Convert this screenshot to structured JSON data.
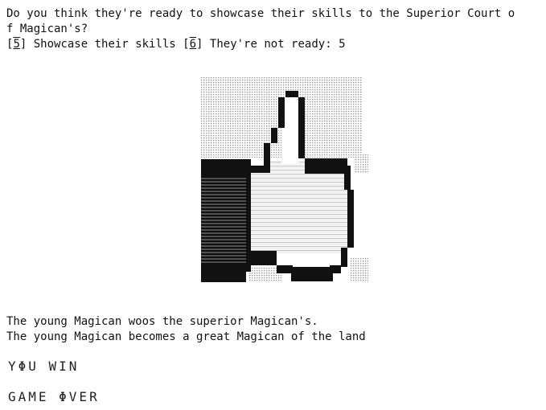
{
  "prompt": {
    "line1": "Do you think they're ready to showcase their skills to the Superior Court o",
    "line2": "f Magican's?"
  },
  "choices": {
    "option1_key": "5",
    "option1_label": "Showcase their skills",
    "option2_key": "6",
    "option2_label": "They're not ready:",
    "selected_value": "5"
  },
  "art": {
    "icon": "thumbs-up-icon"
  },
  "story": {
    "line1": "The young Magican woos the superior Magican's.",
    "line2": "The young Magican becomes a great Magican of the land"
  },
  "result": {
    "win_text": "YΦU WIN",
    "gameover_text": "GAME ΦVER"
  }
}
